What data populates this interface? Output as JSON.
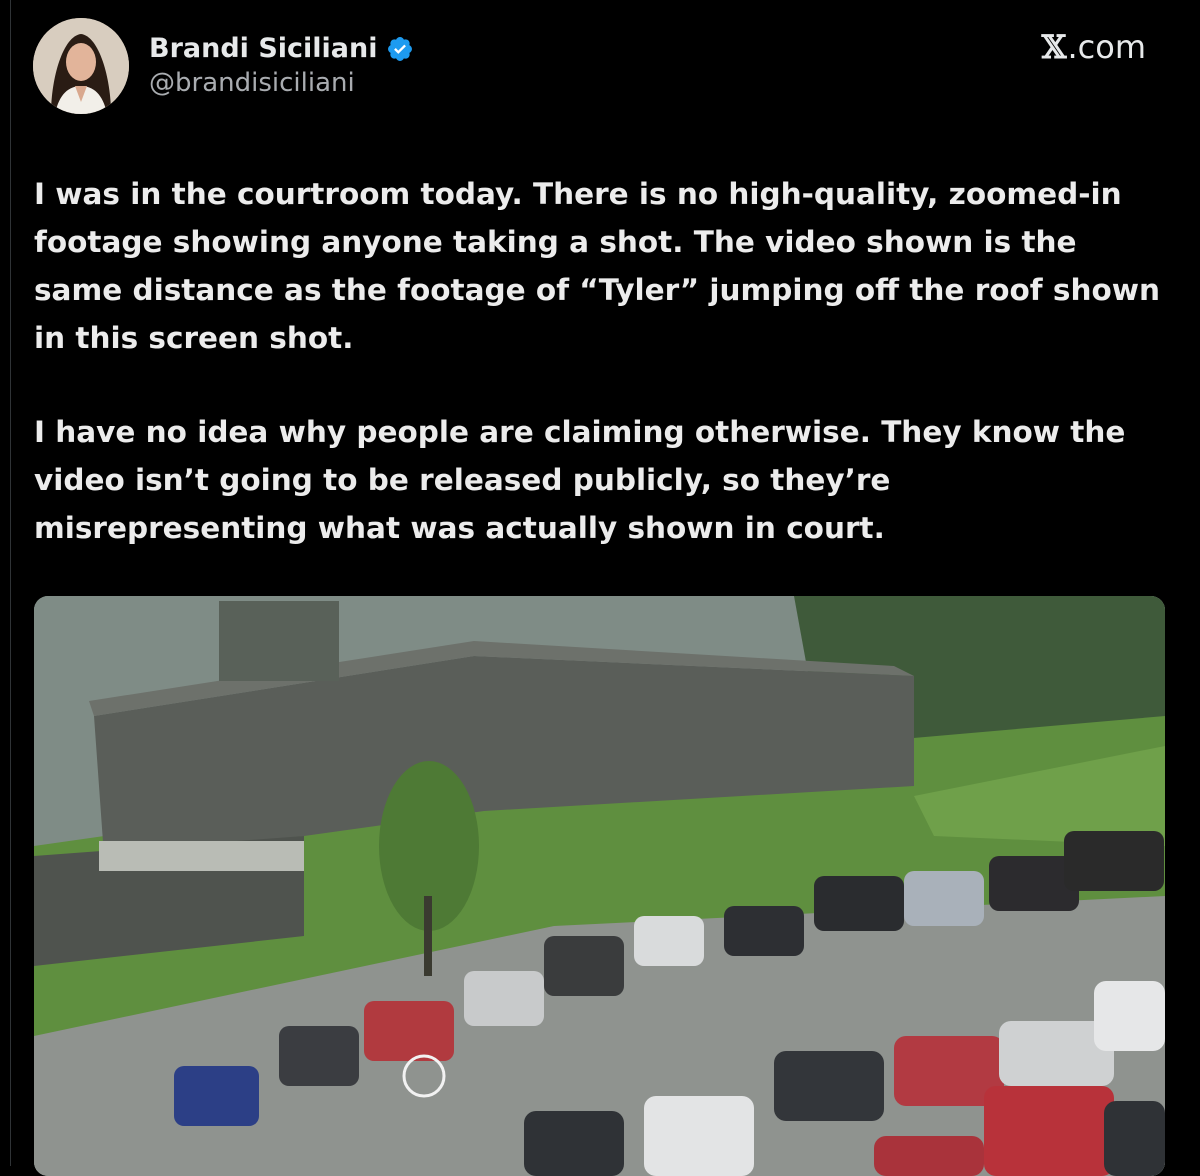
{
  "author": {
    "display_name": "Brandi Siciliani",
    "handle": "@brandisiciliani",
    "verified": true,
    "avatar_icon": "profile-photo"
  },
  "site": {
    "label": ".com",
    "logo_glyph": "𝕏"
  },
  "tweet": {
    "paragraphs": [
      "I was in the courtroom today. There is no high-quality, zoomed-in footage showing anyone taking a shot. The video shown is the same distance as the footage of “Tyler” jumping off the roof shown in this screen shot.",
      "I have no idea why people are claiming otherwise. They know the video isn’t going to be released publicly, so they’re misrepresenting what was actually shown in court."
    ]
  },
  "media": {
    "type": "image",
    "description_icon": "surveillance-photo"
  },
  "colors": {
    "background": "#000000",
    "text": "#e7e9ea",
    "secondary_text": "#a9acb0",
    "verified_blue": "#1d9bf0"
  }
}
